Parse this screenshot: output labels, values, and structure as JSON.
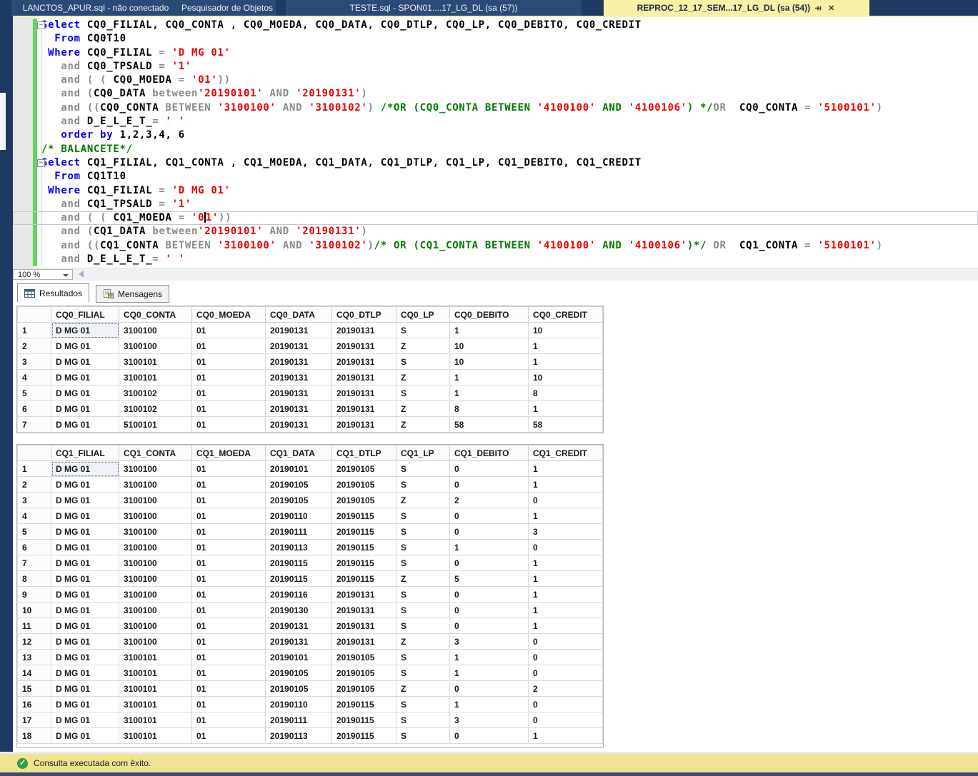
{
  "title_tabs": [
    {
      "label": "LANCTOS_APUR.sql - não conectado",
      "state": "inactive"
    },
    {
      "label": "Pesquisador de Objetos",
      "state": "inactive"
    },
    {
      "label": "TESTE.sql - SPON01....17_LG_DL (sa (57))",
      "state": "inactive"
    },
    {
      "label": "REPROC_12_17_SEM...17_LG_DL (sa (54))",
      "state": "active",
      "pin": true,
      "close": true
    }
  ],
  "editor": {
    "zoom_level": "100 %",
    "lines": [
      {
        "fold": true,
        "tokens": [
          [
            "k",
            "Select"
          ],
          [
            "w",
            " "
          ],
          [
            "i",
            "CQ0_FILIAL, CQ0_CONTA , CQ0_MOEDA, CQ0_DATA, CQ0_DTLP, CQ0_LP, CQ0_DEBITO, CQ0_CREDIT"
          ]
        ]
      },
      {
        "tokens": [
          [
            "w",
            "  "
          ],
          [
            "k",
            "From"
          ],
          [
            "w",
            " "
          ],
          [
            "i",
            "CQ0T10"
          ]
        ]
      },
      {
        "tokens": [
          [
            "w",
            " "
          ],
          [
            "k",
            "Where"
          ],
          [
            "w",
            " "
          ],
          [
            "i",
            "CQ0_FILIAL"
          ],
          [
            "o",
            " = "
          ],
          [
            "s",
            "'D MG 01'"
          ]
        ]
      },
      {
        "tokens": [
          [
            "w",
            "   "
          ],
          [
            "o",
            "and"
          ],
          [
            "w",
            " "
          ],
          [
            "i",
            "CQ0_TPSALD"
          ],
          [
            "o",
            " = "
          ],
          [
            "s",
            "'1'"
          ]
        ]
      },
      {
        "tokens": [
          [
            "w",
            "   "
          ],
          [
            "o",
            "and ( ("
          ],
          [
            "w",
            " "
          ],
          [
            "i",
            "CQ0_MOEDA"
          ],
          [
            "o",
            " = "
          ],
          [
            "s",
            "'01'"
          ],
          [
            "o",
            "))"
          ]
        ]
      },
      {
        "tokens": [
          [
            "w",
            "   "
          ],
          [
            "o",
            "and ("
          ],
          [
            "i",
            "CQ0_DATA"
          ],
          [
            "w",
            " "
          ],
          [
            "o",
            "between"
          ],
          [
            "s",
            "'20190101'"
          ],
          [
            "o",
            " AND "
          ],
          [
            "s",
            "'20190131'"
          ],
          [
            "o",
            ")"
          ]
        ]
      },
      {
        "tokens": [
          [
            "w",
            "   "
          ],
          [
            "o",
            "and (("
          ],
          [
            "i",
            "CQ0_CONTA"
          ],
          [
            "w",
            " "
          ],
          [
            "o",
            "BETWEEN"
          ],
          [
            "w",
            " "
          ],
          [
            "s",
            "'3100100'"
          ],
          [
            "o",
            " AND "
          ],
          [
            "s",
            "'3100102'"
          ],
          [
            "o",
            ") "
          ],
          [
            "c",
            "/*OR (CQ0_CONTA BETWEEN "
          ],
          [
            "s",
            "'4100100'"
          ],
          [
            "c",
            " AND "
          ],
          [
            "s",
            "'4100106'"
          ],
          [
            "c",
            ") */"
          ],
          [
            "o",
            "OR"
          ],
          [
            "w",
            "  "
          ],
          [
            "i",
            "CQ0_CONTA"
          ],
          [
            "o",
            " = "
          ],
          [
            "s",
            "'5100101'"
          ],
          [
            "o",
            ")"
          ]
        ]
      },
      {
        "tokens": [
          [
            "w",
            "   "
          ],
          [
            "o",
            "and"
          ],
          [
            "w",
            " "
          ],
          [
            "i",
            "D_E_L_E_T_"
          ],
          [
            "o",
            "= "
          ],
          [
            "s",
            "' '"
          ]
        ]
      },
      {
        "tokens": [
          [
            "w",
            "   "
          ],
          [
            "k",
            "order by"
          ],
          [
            "w",
            " "
          ],
          [
            "n",
            "1,2,3,4, 6"
          ]
        ]
      },
      {
        "tokens": [
          [
            "c",
            "/* BALANCETE*/"
          ]
        ]
      },
      {
        "fold": true,
        "tokens": [
          [
            "k",
            "Select"
          ],
          [
            "w",
            " "
          ],
          [
            "i",
            "CQ1_FILIAL, CQ1_CONTA , CQ1_MOEDA, CQ1_DATA, CQ1_DTLP, CQ1_LP, CQ1_DEBITO, CQ1_CREDIT"
          ]
        ]
      },
      {
        "tokens": [
          [
            "w",
            "  "
          ],
          [
            "k",
            "From"
          ],
          [
            "w",
            " "
          ],
          [
            "i",
            "CQ1T10"
          ]
        ]
      },
      {
        "tokens": [
          [
            "w",
            " "
          ],
          [
            "k",
            "Where"
          ],
          [
            "w",
            " "
          ],
          [
            "i",
            "CQ1_FILIAL"
          ],
          [
            "o",
            " = "
          ],
          [
            "s",
            "'D MG 01'"
          ]
        ]
      },
      {
        "tokens": [
          [
            "w",
            "   "
          ],
          [
            "o",
            "and"
          ],
          [
            "w",
            " "
          ],
          [
            "i",
            "CQ1_TPSALD"
          ],
          [
            "o",
            " = "
          ],
          [
            "s",
            "'1'"
          ]
        ]
      },
      {
        "current": true,
        "tokens": [
          [
            "w",
            "   "
          ],
          [
            "o",
            "and ( ("
          ],
          [
            "w",
            " "
          ],
          [
            "i",
            "CQ1_MOEDA"
          ],
          [
            "o",
            " = "
          ],
          [
            "s",
            "'0"
          ],
          [
            "caret",
            ""
          ],
          [
            "s",
            "1'"
          ],
          [
            "o",
            "))"
          ]
        ]
      },
      {
        "tokens": [
          [
            "w",
            "   "
          ],
          [
            "o",
            "and ("
          ],
          [
            "i",
            "CQ1_DATA"
          ],
          [
            "w",
            " "
          ],
          [
            "o",
            "between"
          ],
          [
            "s",
            "'20190101'"
          ],
          [
            "o",
            " AND "
          ],
          [
            "s",
            "'20190131'"
          ],
          [
            "o",
            ")"
          ]
        ]
      },
      {
        "tokens": [
          [
            "w",
            "   "
          ],
          [
            "o",
            "and (("
          ],
          [
            "i",
            "CQ1_CONTA"
          ],
          [
            "w",
            " "
          ],
          [
            "o",
            "BETWEEN"
          ],
          [
            "w",
            " "
          ],
          [
            "s",
            "'3100100'"
          ],
          [
            "o",
            " AND "
          ],
          [
            "s",
            "'3100102'"
          ],
          [
            "o",
            ")"
          ],
          [
            "c",
            "/* OR (CQ1_CONTA BETWEEN "
          ],
          [
            "s",
            "'4100100'"
          ],
          [
            "c",
            " AND "
          ],
          [
            "s",
            "'4100106'"
          ],
          [
            "c",
            ")*/"
          ],
          [
            "o",
            " OR"
          ],
          [
            "w",
            "  "
          ],
          [
            "i",
            "CQ1_CONTA"
          ],
          [
            "o",
            " = "
          ],
          [
            "s",
            "'5100101'"
          ],
          [
            "o",
            ")"
          ]
        ]
      },
      {
        "tokens": [
          [
            "w",
            "   "
          ],
          [
            "o",
            "and"
          ],
          [
            "w",
            " "
          ],
          [
            "i",
            "D_E_L_E_T_"
          ],
          [
            "o",
            "= "
          ],
          [
            "s",
            "' '"
          ]
        ]
      }
    ]
  },
  "results": {
    "tabs": [
      {
        "label": "Resultados",
        "active": true
      },
      {
        "label": "Mensagens",
        "active": false
      }
    ],
    "grids": [
      {
        "columns": [
          "",
          "CQ0_FILIAL",
          "CQ0_CONTA",
          "CQ0_MOEDA",
          "CQ0_DATA",
          "CQ0_DTLP",
          "CQ0_LP",
          "CQ0_DEBITO",
          "CQ0_CREDIT"
        ],
        "selected": {
          "row": 0,
          "col": 0
        },
        "rows": [
          [
            "1",
            "D MG 01",
            "3100100",
            "01",
            "20190131",
            "20190131",
            "S",
            "1",
            "10"
          ],
          [
            "2",
            "D MG 01",
            "3100100",
            "01",
            "20190131",
            "20190131",
            "Z",
            "10",
            "1"
          ],
          [
            "3",
            "D MG 01",
            "3100101",
            "01",
            "20190131",
            "20190131",
            "S",
            "10",
            "1"
          ],
          [
            "4",
            "D MG 01",
            "3100101",
            "01",
            "20190131",
            "20190131",
            "Z",
            "1",
            "10"
          ],
          [
            "5",
            "D MG 01",
            "3100102",
            "01",
            "20190131",
            "20190131",
            "S",
            "1",
            "8"
          ],
          [
            "6",
            "D MG 01",
            "3100102",
            "01",
            "20190131",
            "20190131",
            "Z",
            "8",
            "1"
          ],
          [
            "7",
            "D MG 01",
            "5100101",
            "01",
            "20190131",
            "20190131",
            "Z",
            "58",
            "58"
          ]
        ]
      },
      {
        "columns": [
          "",
          "CQ1_FILIAL",
          "CQ1_CONTA",
          "CQ1_MOEDA",
          "CQ1_DATA",
          "CQ1_DTLP",
          "CQ1_LP",
          "CQ1_DEBITO",
          "CQ1_CREDIT"
        ],
        "selected": {
          "row": 0,
          "col": 0
        },
        "rows": [
          [
            "1",
            "D MG 01",
            "3100100",
            "01",
            "20190101",
            "20190105",
            "S",
            "0",
            "1"
          ],
          [
            "2",
            "D MG 01",
            "3100100",
            "01",
            "20190105",
            "20190105",
            "S",
            "0",
            "1"
          ],
          [
            "3",
            "D MG 01",
            "3100100",
            "01",
            "20190105",
            "20190105",
            "Z",
            "2",
            "0"
          ],
          [
            "4",
            "D MG 01",
            "3100100",
            "01",
            "20190110",
            "20190115",
            "S",
            "0",
            "1"
          ],
          [
            "5",
            "D MG 01",
            "3100100",
            "01",
            "20190111",
            "20190115",
            "S",
            "0",
            "3"
          ],
          [
            "6",
            "D MG 01",
            "3100100",
            "01",
            "20190113",
            "20190115",
            "S",
            "1",
            "0"
          ],
          [
            "7",
            "D MG 01",
            "3100100",
            "01",
            "20190115",
            "20190115",
            "S",
            "0",
            "1"
          ],
          [
            "8",
            "D MG 01",
            "3100100",
            "01",
            "20190115",
            "20190115",
            "Z",
            "5",
            "1"
          ],
          [
            "9",
            "D MG 01",
            "3100100",
            "01",
            "20190116",
            "20190131",
            "S",
            "0",
            "1"
          ],
          [
            "10",
            "D MG 01",
            "3100100",
            "01",
            "20190130",
            "20190131",
            "S",
            "0",
            "1"
          ],
          [
            "11",
            "D MG 01",
            "3100100",
            "01",
            "20190131",
            "20190131",
            "S",
            "0",
            "1"
          ],
          [
            "12",
            "D MG 01",
            "3100100",
            "01",
            "20190131",
            "20190131",
            "Z",
            "3",
            "0"
          ],
          [
            "13",
            "D MG 01",
            "3100101",
            "01",
            "20190101",
            "20190105",
            "S",
            "1",
            "0"
          ],
          [
            "14",
            "D MG 01",
            "3100101",
            "01",
            "20190105",
            "20190105",
            "S",
            "1",
            "0"
          ],
          [
            "15",
            "D MG 01",
            "3100101",
            "01",
            "20190105",
            "20190105",
            "Z",
            "0",
            "2"
          ],
          [
            "16",
            "D MG 01",
            "3100101",
            "01",
            "20190110",
            "20190115",
            "S",
            "1",
            "0"
          ],
          [
            "17",
            "D MG 01",
            "3100101",
            "01",
            "20190111",
            "20190115",
            "S",
            "3",
            "0"
          ],
          [
            "18",
            "D MG 01",
            "3100101",
            "01",
            "20190113",
            "20190115",
            "S",
            "0",
            "1"
          ]
        ]
      }
    ]
  },
  "status_bar": {
    "icon": "success-check-icon",
    "message": "Consulta executada com êxito."
  },
  "colors": {
    "title_bar": "#1E3A63",
    "active_tab": "#F8F2A6",
    "status_bar": "#EDE390",
    "keyword": "#0000F0",
    "string": "#EE0000",
    "comment": "#007A00",
    "operator": "#8a8a8a",
    "change_bar": "#5FD75F"
  }
}
